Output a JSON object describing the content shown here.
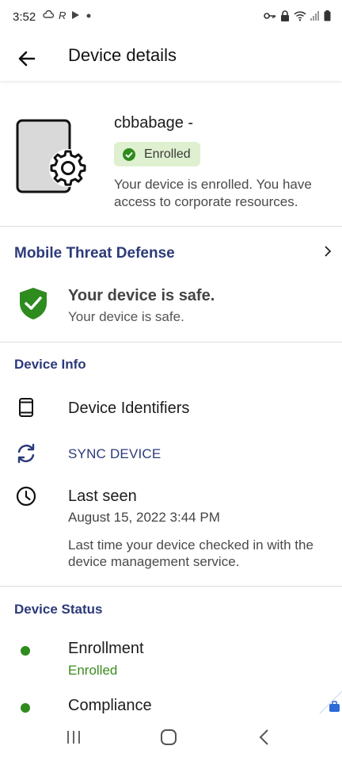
{
  "status_bar": {
    "time": "3:52",
    "left_icons": [
      "cloud-icon",
      "r-app-icon",
      "play-icon",
      "dot-icon"
    ],
    "right_icons": [
      "key-icon",
      "lock-icon",
      "wifi-icon",
      "signal-icon",
      "battery-icon"
    ]
  },
  "app_bar": {
    "title": "Device details"
  },
  "device": {
    "name": "cbbabage -",
    "badge": "Enrolled",
    "description": "Your device is enrolled. You have access to corporate resources."
  },
  "mtd": {
    "title": "Mobile Threat Defense",
    "status_title": "Your device is safe.",
    "status_sub": "Your device is safe."
  },
  "device_info": {
    "heading": "Device Info",
    "identifiers_label": "Device Identifiers",
    "sync_label": "SYNC DEVICE",
    "last_seen_label": "Last seen",
    "last_seen_value": "August 15, 2022 3:44 PM",
    "last_seen_desc": "Last time your device checked in with the device management service."
  },
  "device_status": {
    "heading": "Device Status",
    "items": [
      {
        "label": "Enrollment",
        "value": "Enrolled"
      },
      {
        "label": "Compliance",
        "value": ""
      }
    ]
  },
  "colors": {
    "accent": "#2c3a7a",
    "success": "#2e8b1e",
    "badge_bg": "#dff0d0"
  }
}
